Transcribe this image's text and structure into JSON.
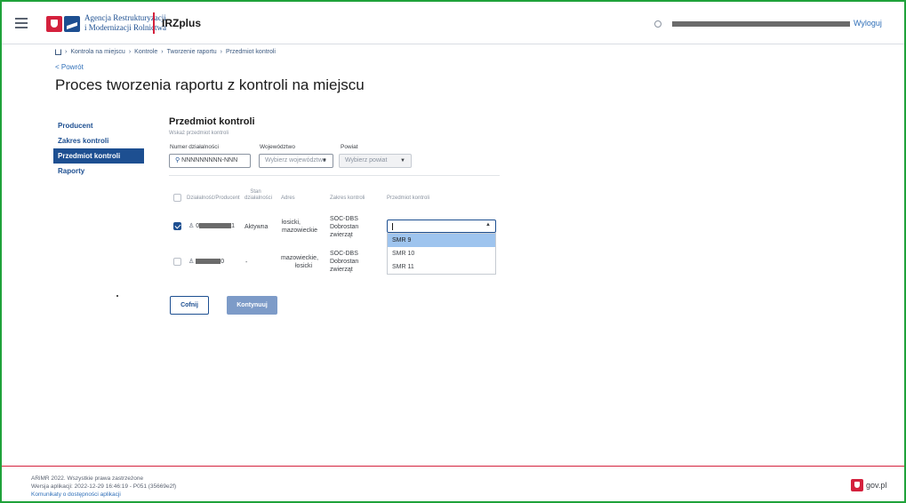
{
  "header": {
    "logo_line1": "Agencja Restrukturyzacji",
    "logo_line2": "i Modernizacji Rolnictwa",
    "app_name": "IRZplus",
    "logout_label": "Wyloguj"
  },
  "breadcrumb": [
    "Kontrola na miejscu",
    "Kontrole",
    "Tworzenie raportu",
    "Przedmiot kontroli"
  ],
  "back_label": "< Powrót",
  "page_title": "Proces tworzenia raportu z kontroli na miejscu",
  "sidenav": {
    "items": [
      {
        "label": "Producent"
      },
      {
        "label": "Zakres kontroli"
      },
      {
        "label": "Przedmiot kontroli"
      },
      {
        "label": "Raporty"
      }
    ],
    "active": "Przedmiot kontroli"
  },
  "section": {
    "title": "Przedmiot kontroli",
    "subtitle": "Wskaż przedmiot kontroli"
  },
  "filters": {
    "numer_label": "Numer działalności",
    "numer_placeholder": "NNNNNNNNN-NNN",
    "wojewodztwo_label": "Województwo",
    "wojewodztwo_value": "Wybierz województwo",
    "powiat_label": "Powiat",
    "powiat_value": "Wybierz powiat"
  },
  "table": {
    "headers": {
      "dzialalnosc": "Działalność/Producent",
      "stan_line1": "Stan",
      "stan_line2": "działalności",
      "adres": "Adres",
      "zakres": "Zakres kontroli",
      "przedmiot": "Przedmiot kontroli"
    },
    "rows": [
      {
        "id_prefix": "0",
        "id_suffix": "1",
        "status": "Aktywna",
        "adres_line1": "łosicki,",
        "adres_line2": "mazowieckie",
        "zakres_line1": "SOC-DBS",
        "zakres_line2": "Dobrostan",
        "zakres_line3": "zwierząt",
        "checked": true
      },
      {
        "id_prefix": "",
        "id_suffix": "0",
        "status": "-",
        "adres_line1": "mazowieckie,",
        "adres_line2": "łosicki",
        "zakres_line1": "SOC-DBS",
        "zakres_line2": "Dobrostan",
        "zakres_line3": "zwierząt",
        "checked": false
      }
    ]
  },
  "dropdown": {
    "options": [
      "SMR 9",
      "SMR 10",
      "SMR 11"
    ],
    "highlighted": "SMR 9"
  },
  "buttons": {
    "back": "Cofnij",
    "continue": "Kontynuuj"
  },
  "footer": {
    "copyright": "ARiMR 2022. Wszystkie prawa zastrzeżone",
    "version": "Wersja aplikacji: 2022-12-29 16:46:19 - P051 (35669e2f)",
    "accessibility_link": "Komunikaty o dostępności aplikacji",
    "govpl": "gov.pl"
  },
  "colors": {
    "primary": "#1d4f91",
    "accent_red": "#d4213d",
    "frame_green": "#1fa23a",
    "dropdown_highlight": "#9ec4ee"
  }
}
